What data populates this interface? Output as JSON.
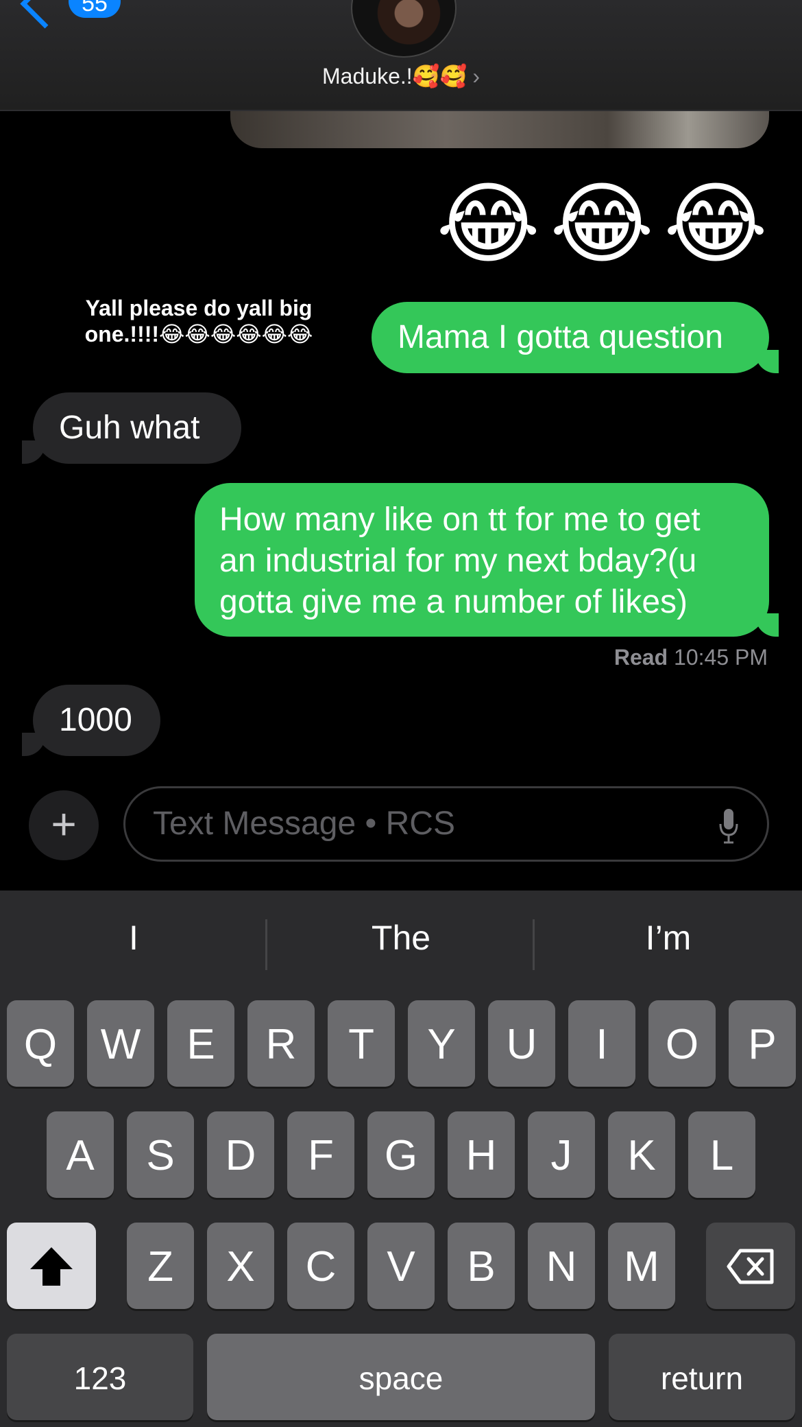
{
  "header": {
    "back_count": "55",
    "contact_name": "Maduke.!🥰🥰",
    "contact_chevron": "›"
  },
  "messages": {
    "emoji_row": [
      "😂",
      "😂",
      "😂"
    ],
    "reaction_caption": "Yall please do yall big one.!!!!😂😂😂😂😂😂",
    "sent_1": "Mama I gotta question",
    "recv_1": "Guh what",
    "sent_2": "How many like on tt for me to get an industrial for my next bday?(u gotta give me a number of likes)",
    "read_label": "Read",
    "read_time": "10:45 PM",
    "recv_2": "1000"
  },
  "compose": {
    "plus": "+",
    "placeholder": "Text Message • RCS"
  },
  "keyboard": {
    "suggestions": [
      "I",
      "The",
      "I’m"
    ],
    "row1": [
      "Q",
      "W",
      "E",
      "R",
      "T",
      "Y",
      "U",
      "I",
      "O",
      "P"
    ],
    "row2": [
      "A",
      "S",
      "D",
      "F",
      "G",
      "H",
      "J",
      "K",
      "L"
    ],
    "row3": [
      "Z",
      "X",
      "C",
      "V",
      "B",
      "N",
      "M"
    ],
    "numbers": "123",
    "space": "space",
    "return": "return"
  },
  "colors": {
    "sent_bubble": "#34c759",
    "recv_bubble": "#262628",
    "accent": "#0a84ff"
  }
}
